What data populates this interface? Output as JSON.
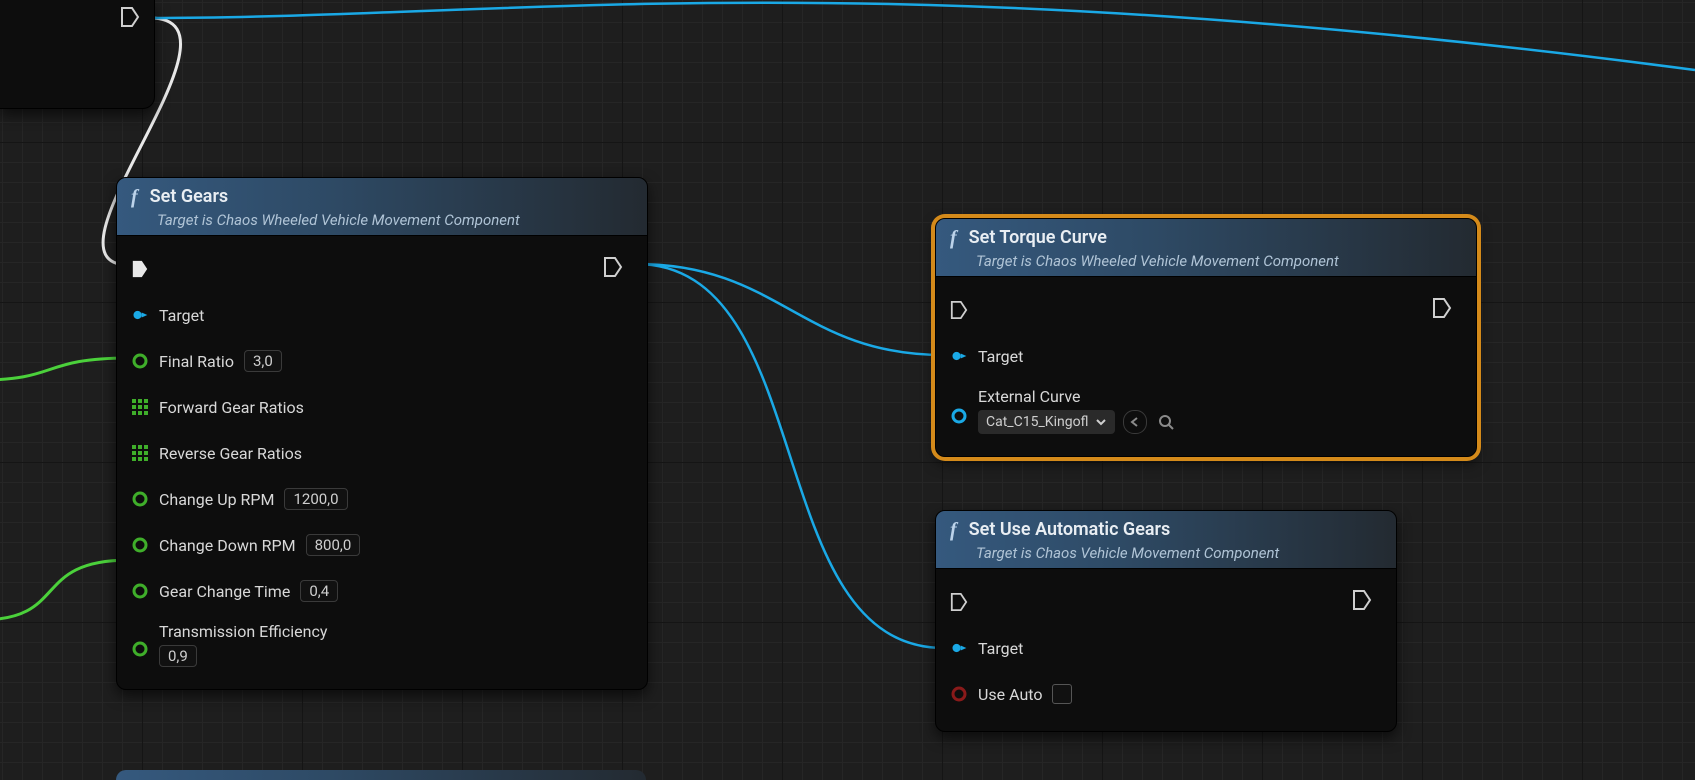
{
  "stub": {
    "visible": true
  },
  "nodes": {
    "setGears": {
      "title": "Set Gears",
      "subtitle": "Target is Chaos Wheeled Vehicle Movement Component",
      "pins": {
        "target": "Target",
        "finalRatio": {
          "label": "Final Ratio",
          "value": "3,0"
        },
        "forwardGearRatios": "Forward Gear Ratios",
        "reverseGearRatios": "Reverse Gear Ratios",
        "changeUpRPM": {
          "label": "Change Up RPM",
          "value": "1200,0"
        },
        "changeDownRPM": {
          "label": "Change Down RPM",
          "value": "800,0"
        },
        "gearChangeTime": {
          "label": "Gear Change Time",
          "value": "0,4"
        },
        "transmissionEfficiency": {
          "label": "Transmission Efficiency",
          "value": "0,9"
        }
      }
    },
    "setTorqueCurve": {
      "title": "Set Torque Curve",
      "subtitle": "Target is Chaos Wheeled Vehicle Movement Component",
      "pins": {
        "target": "Target",
        "externalCurve": {
          "label": "External Curve",
          "value": "Cat_C15_Kingofl"
        }
      }
    },
    "setUseAutoGears": {
      "title": "Set Use Automatic Gears",
      "subtitle": "Target is Chaos Vehicle Movement Component",
      "pins": {
        "target": "Target",
        "useAuto": "Use Auto"
      }
    }
  }
}
